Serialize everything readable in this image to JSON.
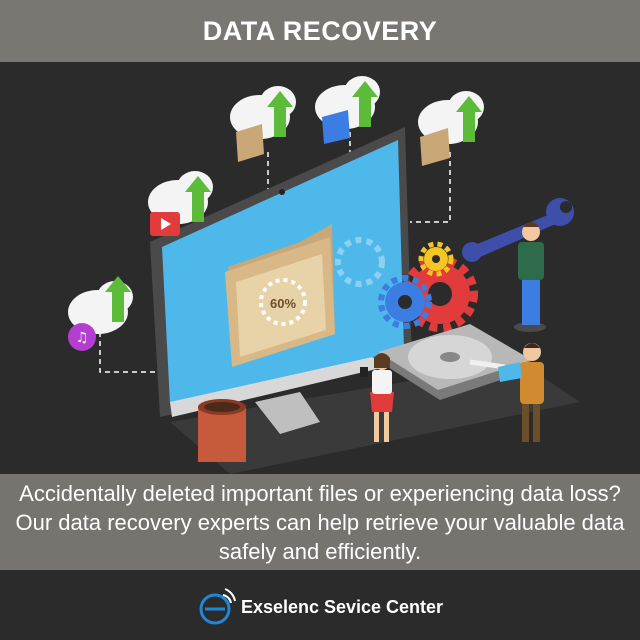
{
  "header": {
    "title": "DATA RECOVERY"
  },
  "illustration": {
    "progress_label": "60%"
  },
  "message": {
    "text": "Accidentally deleted important files or experiencing data loss? Our data recovery experts can help retrieve your valuable data safely and efficiently."
  },
  "footer": {
    "brand_name": "Exselenc Sevice Center",
    "logo_icon": "e-wifi-logo-icon"
  },
  "colors": {
    "title_bar": "#7a7672",
    "background": "#2b2b2b",
    "message_box": "#77736f",
    "screen_blue": "#4fb8ea",
    "cloud": "#f4f4f4",
    "arrow_green": "#5dbb3a",
    "gear_red": "#e23b3b",
    "gear_blue": "#3b7de2",
    "gear_yellow": "#f3c623",
    "wrench": "#3d4fa8",
    "logo_blue": "#1e88d8"
  }
}
